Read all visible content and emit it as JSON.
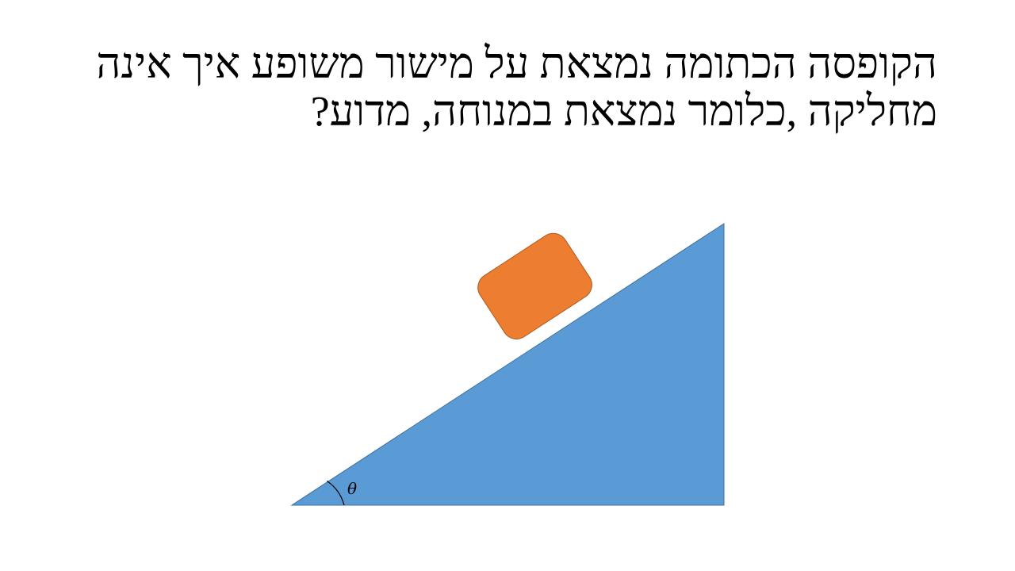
{
  "slide": {
    "title_line_1": "הקופסה הכתומה נמצאת על מישור משופע איך אינה",
    "title_line_2": "מחליקה ,כלומר נמצאת במנוחה, מדוע?"
  },
  "diagram": {
    "angle_label": "θ",
    "colors": {
      "incline": "#5b9bd5",
      "incline_border": "#41719c",
      "box": "#ed7d31",
      "box_border": "#ae5a21",
      "angle_arc": "#000000"
    }
  }
}
